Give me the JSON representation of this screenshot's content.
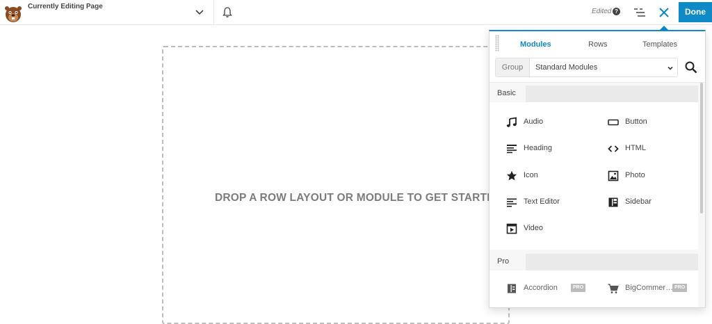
{
  "topbar": {
    "title": "Currently Editing Page",
    "edited_label": "Edited",
    "help_glyph": "?",
    "done_label": "Done"
  },
  "canvas": {
    "drop_text": "DROP A ROW LAYOUT OR MODULE TO GET STARTED"
  },
  "panel": {
    "tabs": [
      {
        "label": "Modules",
        "active": true
      },
      {
        "label": "Rows",
        "active": false
      },
      {
        "label": "Templates",
        "active": false
      }
    ],
    "group_label": "Group",
    "group_value": "Standard Modules",
    "sections": [
      {
        "name": "Basic",
        "modules": [
          {
            "label": "Audio",
            "icon": "audio-icon"
          },
          {
            "label": "Button",
            "icon": "button-icon"
          },
          {
            "label": "Heading",
            "icon": "heading-icon"
          },
          {
            "label": "HTML",
            "icon": "html-icon"
          },
          {
            "label": "Icon",
            "icon": "star-icon"
          },
          {
            "label": "Photo",
            "icon": "photo-icon"
          },
          {
            "label": "Text Editor",
            "icon": "text-editor-icon"
          },
          {
            "label": "Sidebar",
            "icon": "sidebar-icon"
          },
          {
            "label": "Video",
            "icon": "video-icon"
          }
        ]
      },
      {
        "name": "Pro",
        "modules": [
          {
            "label": "Accordion",
            "icon": "accordion-icon",
            "badge": "PRO"
          },
          {
            "label": "BigCommer…",
            "icon": "cart-icon",
            "badge": "PRO"
          }
        ]
      }
    ]
  },
  "colors": {
    "accent": "#0e8ac9",
    "done_bg": "#0e8ac9",
    "drop_text": "#7c7c7c",
    "badge_bg": "#bbbbbb"
  }
}
